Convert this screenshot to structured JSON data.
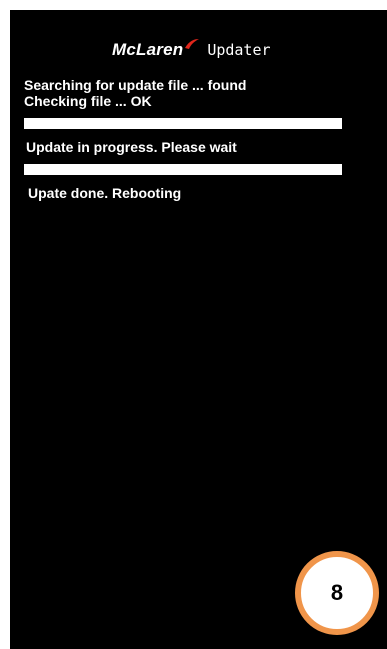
{
  "header": {
    "brand": "McLaren",
    "title": "Updater"
  },
  "log": {
    "line1": "Searching for update file ... found",
    "line2": "Checking file ... OK",
    "line3": "Update in progress. Please wait",
    "line4": "Upate done. Rebooting"
  },
  "progress": {
    "bar1_fraction": 1.0,
    "bar2_fraction": 1.0
  },
  "badge": {
    "step": "8"
  },
  "colors": {
    "screen_bg": "#000000",
    "text": "#ffffff",
    "bar_fill": "#ffffff",
    "badge_ring": "#f0954a",
    "logo_swoosh": "#e0261b"
  }
}
